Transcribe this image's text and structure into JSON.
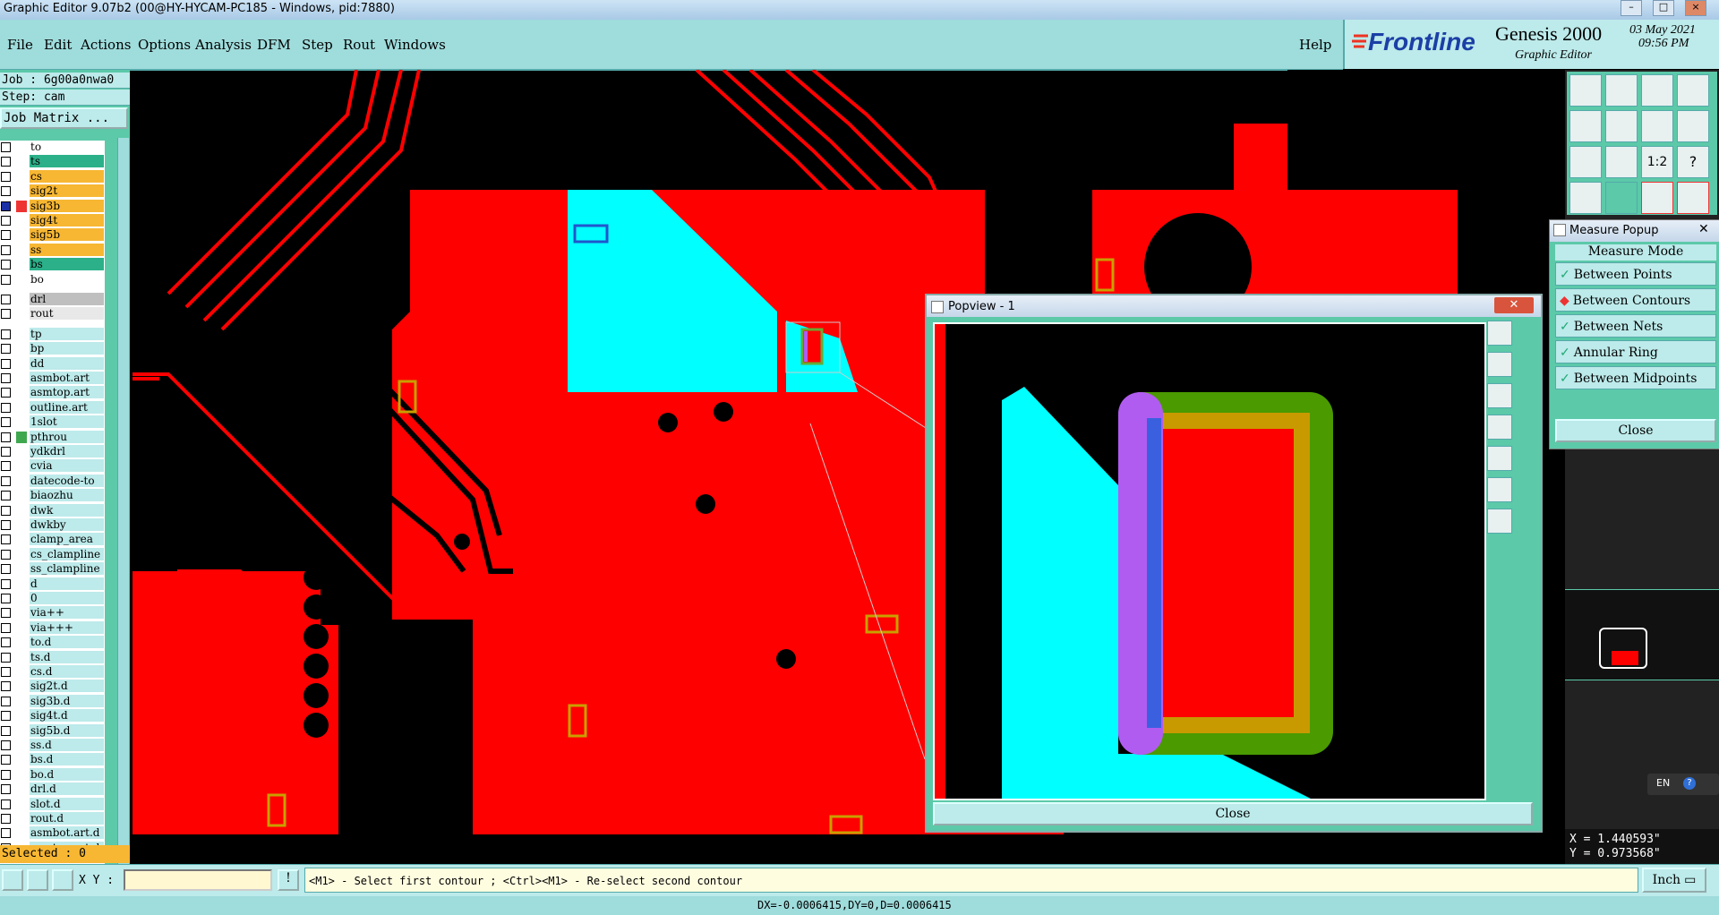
{
  "window": {
    "title": "Graphic Editor 9.07b2 (00@HY-HYCAM-PC185 - Windows, pid:7880)"
  },
  "menu": {
    "items": [
      "File",
      "Edit",
      "Actions",
      "Options",
      "Analysis",
      "DFM",
      "Step",
      "Rout",
      "Windows"
    ],
    "help": "Help"
  },
  "brand": {
    "logo": "Frontline",
    "product": "Genesis 2000",
    "subtitle": "Graphic Editor",
    "date": "03 May 2021",
    "time": "09:56 PM"
  },
  "job": {
    "job_label": "Job : 6g00a0nwa0",
    "step_label": "Step: cam",
    "matrix_button": "Job Matrix ..."
  },
  "layers": [
    {
      "name": "to",
      "color": "#ffffff"
    },
    {
      "name": "ts",
      "color": "#2bb08a"
    },
    {
      "name": "cs",
      "color": "#f7b733"
    },
    {
      "name": "sig2t",
      "color": "#f7b733"
    },
    {
      "name": "sig3b",
      "color": "#f7b733",
      "active": true
    },
    {
      "name": "sig4t",
      "color": "#f7b733"
    },
    {
      "name": "sig5b",
      "color": "#f7b733"
    },
    {
      "name": "ss",
      "color": "#f7b733"
    },
    {
      "name": "bs",
      "color": "#2bb08a"
    },
    {
      "name": "bo",
      "color": "#ffffff"
    },
    {
      "name": "drl",
      "color": "#bfbfbf",
      "gap": true
    },
    {
      "name": "rout",
      "color": "#e8e8e8"
    },
    {
      "name": "tp",
      "color": "#bdeaea",
      "gap": true
    },
    {
      "name": "bp",
      "color": "#bdeaea"
    },
    {
      "name": "dd",
      "color": "#bdeaea"
    },
    {
      "name": "asmbot.art",
      "color": "#bdeaea"
    },
    {
      "name": "asmtop.art",
      "color": "#bdeaea"
    },
    {
      "name": "outline.art",
      "color": "#bdeaea"
    },
    {
      "name": "1slot",
      "color": "#bdeaea"
    },
    {
      "name": "pthrou",
      "color": "#bdeaea",
      "swatch": "#3fa84f"
    },
    {
      "name": "ydkdrl",
      "color": "#bdeaea"
    },
    {
      "name": "cvia",
      "color": "#bdeaea"
    },
    {
      "name": "datecode-to",
      "color": "#bdeaea"
    },
    {
      "name": "biaozhu",
      "color": "#bdeaea"
    },
    {
      "name": "dwk",
      "color": "#bdeaea"
    },
    {
      "name": "dwkby",
      "color": "#bdeaea"
    },
    {
      "name": "clamp_area",
      "color": "#bdeaea"
    },
    {
      "name": "cs_clampline",
      "color": "#bdeaea"
    },
    {
      "name": "ss_clampline",
      "color": "#bdeaea"
    },
    {
      "name": "d",
      "color": "#bdeaea"
    },
    {
      "name": "0",
      "color": "#bdeaea"
    },
    {
      "name": "via++",
      "color": "#bdeaea"
    },
    {
      "name": "via+++",
      "color": "#bdeaea"
    },
    {
      "name": "to.d",
      "color": "#bdeaea"
    },
    {
      "name": "ts.d",
      "color": "#bdeaea"
    },
    {
      "name": "cs.d",
      "color": "#bdeaea"
    },
    {
      "name": "sig2t.d",
      "color": "#bdeaea"
    },
    {
      "name": "sig3b.d",
      "color": "#bdeaea"
    },
    {
      "name": "sig4t.d",
      "color": "#bdeaea"
    },
    {
      "name": "sig5b.d",
      "color": "#bdeaea"
    },
    {
      "name": "ss.d",
      "color": "#bdeaea"
    },
    {
      "name": "bs.d",
      "color": "#bdeaea"
    },
    {
      "name": "bo.d",
      "color": "#bdeaea"
    },
    {
      "name": "drl.d",
      "color": "#bdeaea"
    },
    {
      "name": "slot.d",
      "color": "#bdeaea"
    },
    {
      "name": "rout.d",
      "color": "#bdeaea"
    },
    {
      "name": "asmbot.art.d",
      "color": "#bdeaea"
    },
    {
      "name": "asmtop.art.d",
      "color": "#bdeaea"
    }
  ],
  "selected": "Selected : 0",
  "popview": {
    "title": "Popview - 1",
    "close_label": "Close"
  },
  "measure": {
    "title": "Measure Popup",
    "mode_label": "Measure Mode",
    "options": [
      "Between Points",
      "Between Contours",
      "Between Nets",
      "Annular Ring",
      "Between Midpoints"
    ],
    "selected_option": "Between Contours",
    "close_label": "Close"
  },
  "coords": {
    "x": "X = 1.440593\"",
    "y": "Y = 0.973568\""
  },
  "language": "EN",
  "status": {
    "xy_label": "X Y :",
    "xy_value": "",
    "prompt": "<M1> - Select first contour ; <Ctrl><M1> - Re-select second contour",
    "units": "Inch",
    "delta": "DX=-0.0006415,DY=0,D=0.0006415"
  },
  "colors": {
    "copper": "#ff0000",
    "cyan": "#00ffff",
    "panel": "#5cc9a9",
    "light": "#bdeaea"
  }
}
